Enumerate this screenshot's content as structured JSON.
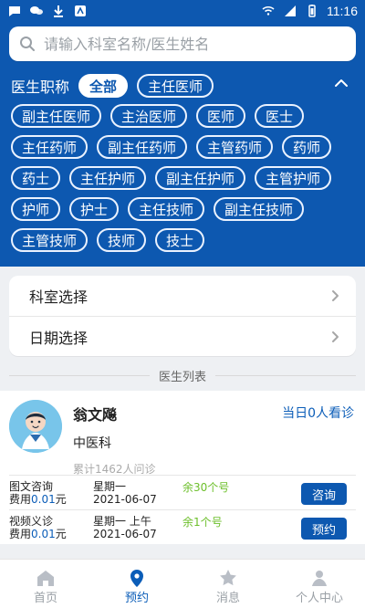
{
  "status_bar": {
    "time": "11:16"
  },
  "search": {
    "placeholder": "请输入科室名称/医生姓名"
  },
  "filters": {
    "label": "医生职称",
    "selected": "全部",
    "chips": [
      {
        "label": "全部",
        "selected": true
      },
      {
        "label": "主任医师",
        "selected": false
      },
      {
        "label": "副主任医师",
        "selected": false
      },
      {
        "label": "主治医师",
        "selected": false
      },
      {
        "label": "医师",
        "selected": false
      },
      {
        "label": "医士",
        "selected": false
      },
      {
        "label": "主任药师",
        "selected": false
      },
      {
        "label": "副主任药师",
        "selected": false
      },
      {
        "label": "主管药师",
        "selected": false
      },
      {
        "label": "药师",
        "selected": false
      },
      {
        "label": "药士",
        "selected": false
      },
      {
        "label": "主任护师",
        "selected": false
      },
      {
        "label": "副主任护师",
        "selected": false
      },
      {
        "label": "主管护师",
        "selected": false
      },
      {
        "label": "护师",
        "selected": false
      },
      {
        "label": "护士",
        "selected": false
      },
      {
        "label": "主任技师",
        "selected": false
      },
      {
        "label": "副主任技师",
        "selected": false
      },
      {
        "label": "主管技师",
        "selected": false
      },
      {
        "label": "技师",
        "selected": false
      },
      {
        "label": "技士",
        "selected": false
      }
    ]
  },
  "selectors": {
    "department": "科室选择",
    "date": "日期选择"
  },
  "doctor_list": {
    "title": "医生列表",
    "doctor": {
      "name": "翁文飚",
      "department": "中医科",
      "consultations": "累计1462人问诊",
      "today": "当日0人看诊",
      "services": [
        {
          "name": "图文咨询",
          "price_prefix": "费用",
          "price": "0.01",
          "price_suffix": "元",
          "weekday": "星期一",
          "date": "2021-06-07",
          "remaining": "余30个号",
          "button": "咨询"
        },
        {
          "name": "视频义诊",
          "price_prefix": "费用",
          "price": "0.01",
          "price_suffix": "元",
          "weekday": "星期一 上午",
          "date": "2021-06-07",
          "remaining": "余1个号",
          "button": "预约"
        }
      ]
    }
  },
  "bottom_nav": {
    "items": [
      {
        "label": "首页",
        "icon": "home-icon",
        "active": false
      },
      {
        "label": "预约",
        "icon": "location-pin-icon",
        "active": true
      },
      {
        "label": "消息",
        "icon": "star-icon",
        "active": false
      },
      {
        "label": "个人中心",
        "icon": "user-icon",
        "active": false
      }
    ]
  },
  "colors": {
    "brand_blue": "#0d58b0",
    "accent_green": "#6cbf2a"
  }
}
